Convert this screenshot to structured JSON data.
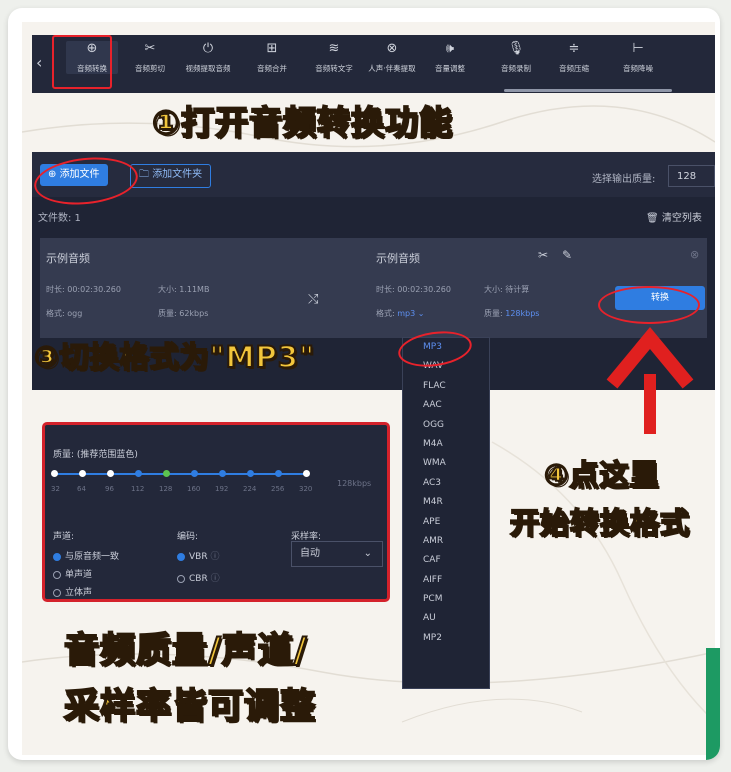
{
  "toolbar": {
    "items": [
      {
        "label": "音频转换",
        "icon": "⊕"
      },
      {
        "label": "音频剪切",
        "icon": "✂"
      },
      {
        "label": "视频提取音频",
        "icon": "⏻"
      },
      {
        "label": "音频合并",
        "icon": "⊞"
      },
      {
        "label": "音频转文字",
        "icon": "≋"
      },
      {
        "label": "人声·伴奏提取",
        "icon": "⊗"
      },
      {
        "label": "音量调整",
        "icon": "🕪"
      },
      {
        "label": "音频录制",
        "icon": "🎙"
      },
      {
        "label": "音频压缩",
        "icon": "≑"
      },
      {
        "label": "音频降噪",
        "icon": "⊢"
      }
    ],
    "back_icon": "‹"
  },
  "captions": {
    "step1": "①打开音频转换功能",
    "step3": "③切换格式为\"MP3\"",
    "step4_line1": "④点这里",
    "step4_line2": "开始转换格式",
    "bottom_line1": "音频质量/声道/",
    "bottom_line2": "采样率皆可调整"
  },
  "app": {
    "add_file": "添加文件",
    "add_folder": "添加文件夹",
    "output_quality_label": "选择输出质量:",
    "output_quality_value": "128",
    "file_count": "文件数: 1",
    "clear_list": "清空列表",
    "file": {
      "source_name": "示例音频",
      "source_duration": "时长: 00:02:30.260",
      "source_size": "大小: 1.11MB",
      "source_format": "格式: ogg",
      "source_quality": "质量: 62kbps",
      "target_name": "示例音频",
      "target_duration": "时长: 00:02:30.260",
      "target_size": "大小: 待计算",
      "target_format_label": "格式:",
      "target_format_value": "mp3",
      "target_quality_label": "质量:",
      "target_quality_value": "128kbps",
      "convert_button": "转换"
    }
  },
  "dropdown": {
    "options": [
      "MP3",
      "WAV",
      "FLAC",
      "AAC",
      "OGG",
      "M4A",
      "WMA",
      "AC3",
      "M4R",
      "APE",
      "AMR",
      "CAF",
      "AIFF",
      "PCM",
      "AU",
      "MP2"
    ],
    "selected": "MP3"
  },
  "settings": {
    "quality_label": "质量: (推荐范围蓝色)",
    "quality_ticks": [
      "32",
      "64",
      "96",
      "112",
      "128",
      "160",
      "192",
      "224",
      "256",
      "320"
    ],
    "quality_value": "128kbps",
    "channel_label": "声道:",
    "channel_options": [
      "与原音频一致",
      "单声道",
      "立体声"
    ],
    "codec_label": "编码:",
    "codec_options": [
      "VBR",
      "CBR"
    ],
    "samplerate_label": "采样率:",
    "samplerate_value": "自动"
  },
  "colors": {
    "accent_blue": "#2f7de1",
    "highlight_red": "#e8222b",
    "caption_gold": "#f2c63c",
    "panel_dark": "#23283a"
  }
}
